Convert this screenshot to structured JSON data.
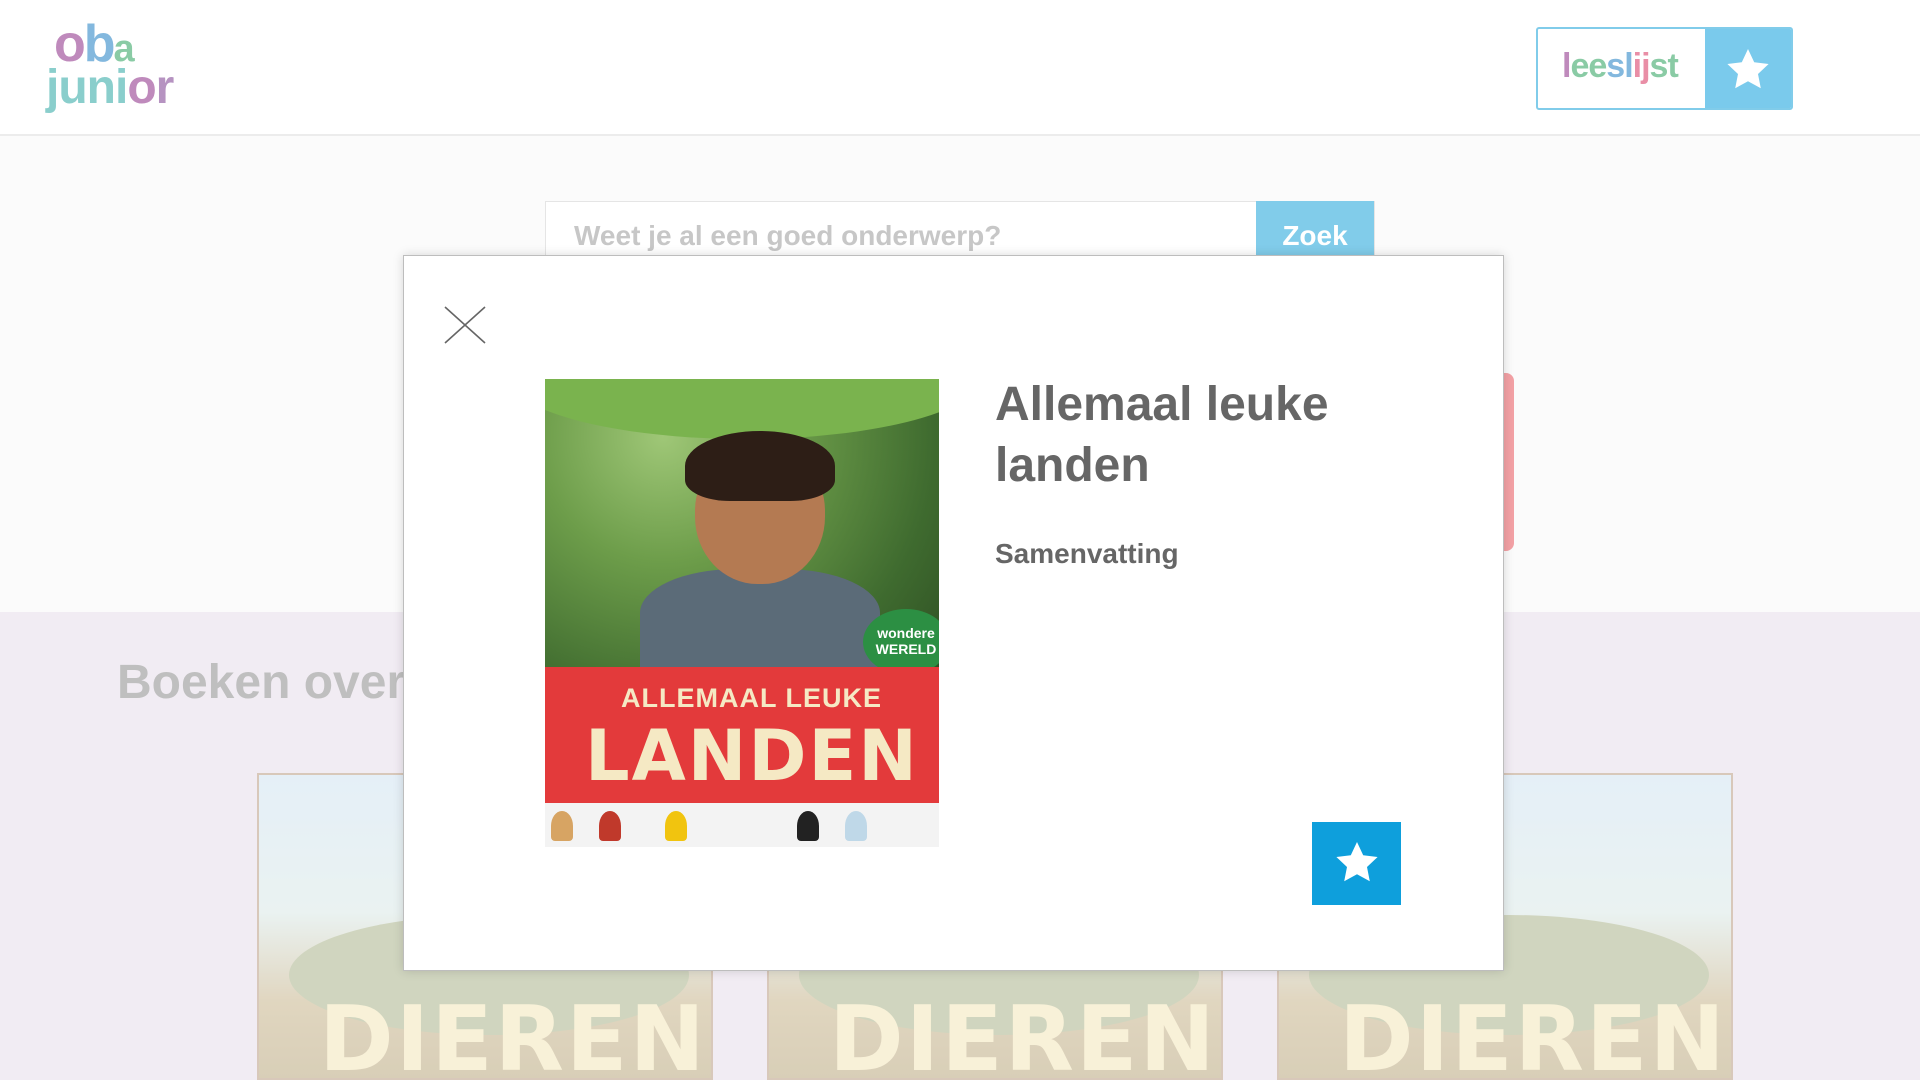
{
  "header": {
    "logo": {
      "line1": "oba",
      "line2": "junior"
    },
    "leeslijst": {
      "label": "leeslijst",
      "icon": "star-icon"
    }
  },
  "search": {
    "placeholder": "Weet je al een goed onderwerp?",
    "button_label": "Zoek"
  },
  "books_section": {
    "title": "Boeken over",
    "items": [
      {
        "cover_title": "DIEREN"
      },
      {
        "cover_title": "DIEREN"
      },
      {
        "cover_title": "DIEREN"
      }
    ]
  },
  "modal": {
    "close_icon": "close-icon",
    "cover": {
      "line1": "ALLEMAAL LEUKE",
      "line2": "LANDEN",
      "badge": "wondere WERELD"
    },
    "title": "Allemaal leuke landen",
    "summary_label": "Samenvatting",
    "add_icon": "star-icon"
  },
  "colors": {
    "accent_blue": "#0e9fdc",
    "text_gray": "#666666",
    "books_bg": "#e6dce9",
    "cover_red": "#e33a3b"
  }
}
